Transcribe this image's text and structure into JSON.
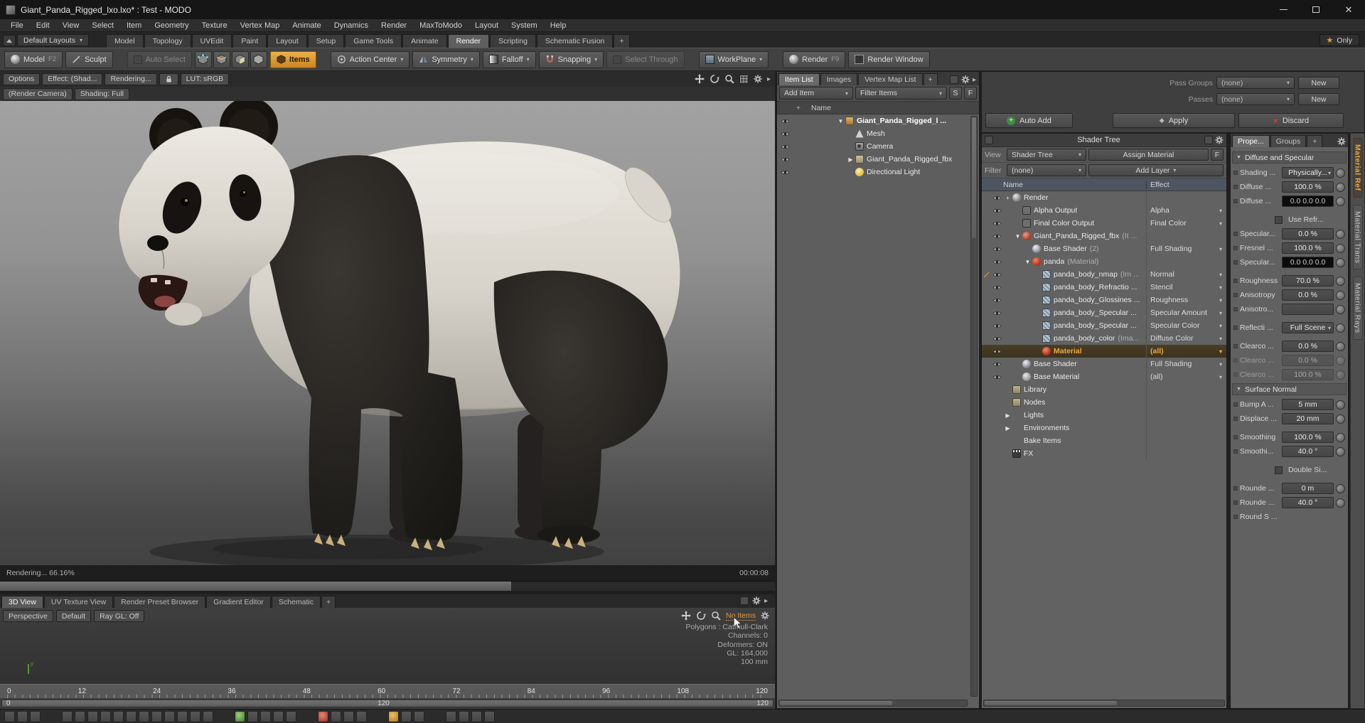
{
  "colors": {
    "accent": "#e09a3a"
  },
  "titlebar": {
    "title": "Giant_Panda_Rigged_lxo.lxo* : Test - MODO"
  },
  "menu": {
    "items": [
      {
        "label": "File"
      },
      {
        "label": "Edit"
      },
      {
        "label": "View"
      },
      {
        "label": "Select"
      },
      {
        "label": "Item"
      },
      {
        "label": "Geometry"
      },
      {
        "label": "Texture"
      },
      {
        "label": "Vertex Map"
      },
      {
        "label": "Animate"
      },
      {
        "label": "Dynamics"
      },
      {
        "label": "Render"
      },
      {
        "label": "MaxToModo"
      },
      {
        "label": "Layout"
      },
      {
        "label": "System"
      },
      {
        "label": "Help"
      }
    ]
  },
  "layoutbar": {
    "preset_label": "Default Layouts",
    "tabs": [
      {
        "label": "Model"
      },
      {
        "label": "Topology"
      },
      {
        "label": "UVEdit"
      },
      {
        "label": "Paint"
      },
      {
        "label": "Layout"
      },
      {
        "label": "Setup"
      },
      {
        "label": "Game Tools"
      },
      {
        "label": "Animate"
      },
      {
        "label": "Render",
        "cls": "active"
      },
      {
        "label": "Scripting"
      },
      {
        "label": "Schematic Fusion"
      },
      {
        "label": "+",
        "cls": "plus"
      }
    ],
    "star": "★",
    "only_label": "Only"
  },
  "toolbar": {
    "model": "Model",
    "model_key": "F2",
    "sculpt": "Sculpt",
    "auto_select": "Auto Select",
    "items": "Items",
    "action_center": "Action Center",
    "symmetry": "Symmetry",
    "falloff": "Falloff",
    "snapping": "Snapping",
    "select_through": "Select Through",
    "workplane": "WorkPlane",
    "render": "Render",
    "render_key": "F9",
    "render_window": "Render Window"
  },
  "viewport": {
    "options": "Options",
    "effect": "Effect: (Shad...",
    "rendering": "Rendering...",
    "lut": "LUT: sRGB",
    "camera": "(Render Camera)",
    "shading": "Shading: Full",
    "progress_text": "Rendering... 66.16%",
    "progress_time": "00:00:08",
    "progress_percent": 66
  },
  "bottom_pane": {
    "tabs": [
      {
        "label": "3D View",
        "cls": "active"
      },
      {
        "label": "UV Texture View"
      },
      {
        "label": "Render Preset Browser"
      },
      {
        "label": "Gradient Editor"
      },
      {
        "label": "Schematic"
      },
      {
        "label": "+",
        "cls": "plus"
      }
    ],
    "buttons": [
      {
        "label": "Perspective"
      },
      {
        "label": "Default"
      },
      {
        "label": "Ray GL: Off"
      }
    ],
    "no_items": "No Items",
    "info": [
      {
        "label": "Polygons : Catmull-Clark"
      },
      {
        "label": "Channels: 0"
      },
      {
        "label": "Deformers: ON"
      },
      {
        "label": "GL: 164,000"
      },
      {
        "label": "100 mm"
      }
    ],
    "axis_label": "y"
  },
  "timeline": {
    "ticks": [
      {
        "label": "0"
      },
      {
        "label": "12"
      },
      {
        "label": "24"
      },
      {
        "label": "36"
      },
      {
        "label": "48"
      },
      {
        "label": "60"
      },
      {
        "label": "72"
      },
      {
        "label": "84"
      },
      {
        "label": "96"
      },
      {
        "label": "108"
      },
      {
        "label": "120"
      }
    ],
    "range_start": "0",
    "range_mid": "120",
    "range_end": "120"
  },
  "bottom_strip": {
    "icons": [
      {
        "cls": "g"
      },
      {
        "cls": "g"
      },
      {
        "cls": "g"
      },
      {
        "cls": "gap"
      },
      {
        "cls": "g"
      },
      {
        "cls": "g"
      },
      {
        "cls": "g"
      },
      {
        "cls": "g"
      },
      {
        "cls": "g"
      },
      {
        "cls": "g"
      },
      {
        "cls": "g"
      },
      {
        "cls": "g"
      },
      {
        "cls": "g"
      },
      {
        "cls": "g"
      },
      {
        "cls": "g"
      },
      {
        "cls": "g"
      },
      {
        "cls": "gap"
      },
      {
        "cls": "gn"
      },
      {
        "cls": "g"
      },
      {
        "cls": "g"
      },
      {
        "cls": "g"
      },
      {
        "cls": "g"
      },
      {
        "cls": "gap"
      },
      {
        "cls": "rd"
      },
      {
        "cls": "g"
      },
      {
        "cls": "g"
      },
      {
        "cls": "g"
      },
      {
        "cls": "gap"
      },
      {
        "cls": "og"
      },
      {
        "cls": "g"
      },
      {
        "cls": "g"
      },
      {
        "cls": "gap"
      },
      {
        "cls": "g"
      },
      {
        "cls": "g"
      },
      {
        "cls": "g"
      },
      {
        "cls": "g"
      }
    ]
  },
  "item_list": {
    "tabs": [
      {
        "label": "Item List",
        "cls": "active"
      },
      {
        "label": "Images"
      },
      {
        "label": "Vertex Map List"
      },
      {
        "label": "+",
        "cls": "plus"
      }
    ],
    "add_item": "Add Item",
    "filter_items": "Filter Items",
    "s": "S",
    "f": "F",
    "plus_col": "+",
    "name_col": "Name",
    "rows": [
      {
        "cls": "ind1 bold",
        "exp": "▼",
        "icon": "ic-pkg",
        "label": "Giant_Panda_Rigged_l ...",
        "eye": "on"
      },
      {
        "cls": "ind2",
        "icon": "ic-mesh",
        "label": "Mesh",
        "eye": "on"
      },
      {
        "cls": "ind2",
        "icon": "ic-cam",
        "label": "Camera",
        "eye": "on"
      },
      {
        "cls": "ind2",
        "exp": "▶",
        "icon": "ic-grp",
        "label": "Giant_Panda_Rigged_fbx",
        "eye": "on"
      },
      {
        "cls": "ind2",
        "icon": "ic-light",
        "label": "Directional Light",
        "eye": "on"
      }
    ]
  },
  "passes": {
    "groups_label": "Pass Groups",
    "groups_value": "(none)",
    "groups_new": "New",
    "passes_label": "Passes",
    "passes_value": "(none)",
    "passes_new": "New",
    "auto_add": "Auto Add",
    "apply": "Apply",
    "discard": "Discard"
  },
  "shader_tree": {
    "title": "Shader Tree",
    "view_label": "View",
    "view_value": "Shader Tree",
    "assign": "Assign Material",
    "f": "F",
    "filter_label": "Filter",
    "filter_value": "(none)",
    "add_layer": "Add Layer",
    "name_col": "Name",
    "effect_col": "Effect",
    "rows": [
      {
        "cls": "ind1",
        "exp": "+",
        "icon": "ic-render",
        "label": "Render",
        "eye": "on"
      },
      {
        "cls": "ind2",
        "icon": "ic-out",
        "label": "Alpha Output",
        "effect": "Alpha",
        "dd": "show",
        "eye": "on"
      },
      {
        "cls": "ind2",
        "icon": "ic-out",
        "label": "Final Color Output",
        "effect": "Final Color",
        "dd": "show",
        "eye": "on"
      },
      {
        "cls": "ind2",
        "exp": "▼",
        "icon": "ic-maskgrp",
        "label": "Giant_Panda_Rigged_fbx",
        "suffix": "(It ...",
        "eye": "on"
      },
      {
        "cls": "ind3",
        "icon": "ic-shader",
        "label": "Base Shader",
        "suffix": "(2)",
        "effect": "Full Shading",
        "dd": "show",
        "eye": "on"
      },
      {
        "cls": "ind3",
        "exp": "▼",
        "icon": "ic-mat",
        "label": "panda",
        "suffix": "(Material)",
        "eye": "on"
      },
      {
        "cls": "ind4",
        "icon": "ic-img",
        "label": "panda_body_nmap",
        "suffix": "(Im ...",
        "effect": "Normal",
        "dd": "show",
        "eye": "on",
        "pencil": "on"
      },
      {
        "cls": "ind4",
        "icon": "ic-img",
        "label": "panda_body_Refractio ...",
        "effect": "Stencil",
        "dd": "show",
        "eye": "on"
      },
      {
        "cls": "ind4",
        "icon": "ic-img",
        "label": "panda_body_Glossines ...",
        "effect": "Roughness",
        "dd": "show",
        "eye": "on"
      },
      {
        "cls": "ind4",
        "icon": "ic-img",
        "label": "panda_body_Specular ...",
        "effect": "Specular Amount",
        "dd": "show",
        "eye": "on"
      },
      {
        "cls": "ind4",
        "icon": "ic-img",
        "label": "panda_body_Specular ...",
        "effect": "Specular Color",
        "dd": "show",
        "eye": "on"
      },
      {
        "cls": "ind4",
        "icon": "ic-img",
        "label": "panda_body_color",
        "suffix": "(Ima...",
        "effect": "Diffuse Color",
        "dd": "show",
        "eye": "on"
      },
      {
        "cls": "ind4 sel",
        "icon": "ic-matsel",
        "label": "Material",
        "effect": "(all)",
        "dd": "show",
        "eye": "on"
      },
      {
        "cls": "ind2",
        "icon": "ic-shader",
        "label": "Base Shader",
        "effect": "Full Shading",
        "dd": "show",
        "eye": "on"
      },
      {
        "cls": "ind2",
        "icon": "ic-ball",
        "label": "Base Material",
        "effect": "(all)",
        "dd": "show",
        "eye": "on"
      },
      {
        "cls": "ind1",
        "icon": "ic-folder",
        "label": "Library"
      },
      {
        "cls": "ind1",
        "icon": "ic-folder",
        "label": "Nodes"
      },
      {
        "cls": "ind1",
        "exp": "▶",
        "label": "Lights"
      },
      {
        "cls": "ind1",
        "exp": "▶",
        "label": "Environments"
      },
      {
        "cls": "ind1",
        "label": "Bake Items"
      },
      {
        "cls": "ind1",
        "icon": "ic-fx",
        "label": "FX"
      }
    ]
  },
  "properties": {
    "tabs": [
      {
        "label": "Prope...",
        "cls": "active"
      },
      {
        "label": "Groups"
      },
      {
        "label": "+",
        "cls": "plus"
      }
    ],
    "sec_diffuse": "Diffuse and Specular",
    "shading_label": "Shading ...",
    "shading_value": "Physically...",
    "diffuse_amt_label": "Diffuse ...",
    "diffuse_amt_value": "100.0 %",
    "diffuse_col_label": "Diffuse ...",
    "diffuse_col_value": "0.0 0.0 0.0",
    "use_refr_label": "Use Refr...",
    "specular_amt_label": "Specular...",
    "specular_amt_value": "0.0 %",
    "fresnel_label": "Fresnel ...",
    "fresnel_value": "100.0 %",
    "specular_col_label": "Specular...",
    "specular_col_value": "0.0 0.0 0.0",
    "roughness_label": "Roughness",
    "roughness_value": "70.0 %",
    "anisotropy_label": "Anisotropy",
    "anisotropy_value": "0.0 %",
    "aniso_dir_label": "Anisotro...",
    "reflection_label": "Reflecti ...",
    "reflection_value": "Full Scene",
    "clearcoat_label": "Clearco ...",
    "clearcoat_value": "0.0 %",
    "clearcoat2_label": "Clearco ...",
    "clearcoat2_value": "0.0 %",
    "clearcoat3_label": "Clearco ...",
    "clearcoat3_value": "100.0 %",
    "sec_surface": "Surface Normal",
    "bump_label": "Bump A ...",
    "bump_value": "5 mm",
    "displace_label": "Displace ...",
    "displace_value": "20 mm",
    "smoothing_label": "Smoothing",
    "smoothing_value": "100.0 %",
    "smooth_angle_label": "Smoothi...",
    "smooth_angle_value": "40.0 °",
    "double_sided_label": "Double Si...",
    "rounded_label": "Rounde ...",
    "rounded_value": "0 m",
    "rounded2_label": "Rounde ...",
    "rounded2_value": "40.0 °",
    "round_s_label": "Round S ...",
    "vtabs": [
      {
        "label": "Material Ref",
        "cls": "active"
      },
      {
        "label": "Material Trans"
      },
      {
        "label": "Material Rays"
      }
    ]
  }
}
